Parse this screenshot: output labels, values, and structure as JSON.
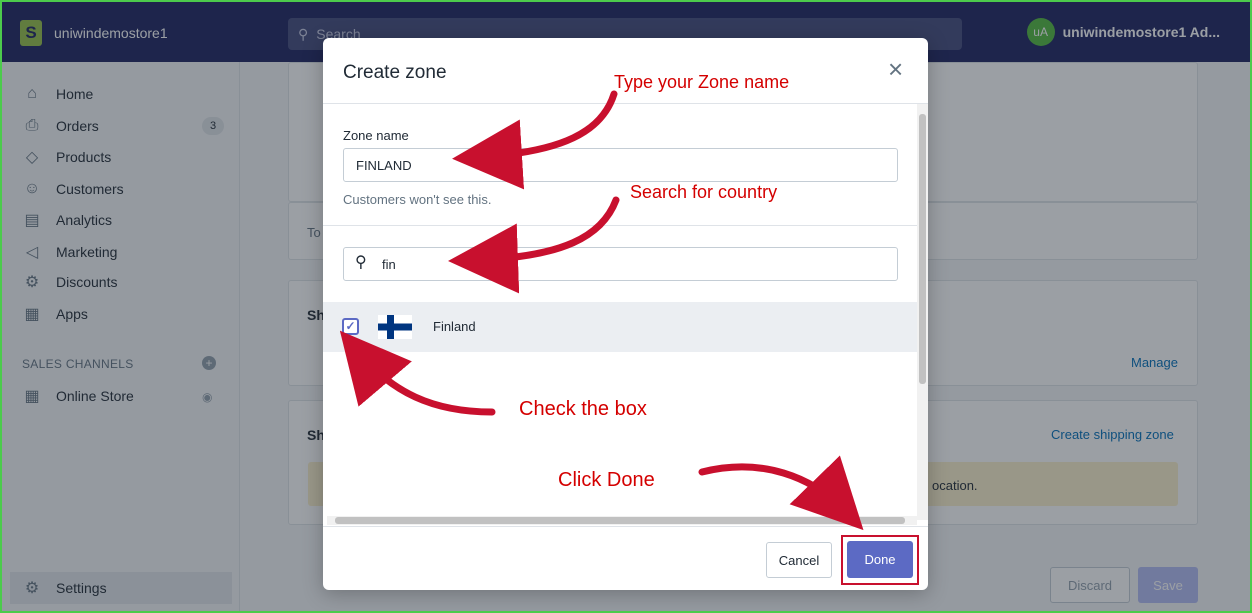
{
  "topbar": {
    "store_name": "uniwindemostore1",
    "search_placeholder": "Search",
    "avatar_initials": "uA",
    "user_label": "uniwindemostore1 Ad..."
  },
  "sidebar": {
    "items": [
      {
        "label": "Home",
        "icon": "home-icon"
      },
      {
        "label": "Orders",
        "icon": "orders-icon",
        "badge": "3"
      },
      {
        "label": "Products",
        "icon": "tag-icon"
      },
      {
        "label": "Customers",
        "icon": "person-icon"
      },
      {
        "label": "Analytics",
        "icon": "bar-chart-icon"
      },
      {
        "label": "Marketing",
        "icon": "megaphone-icon"
      },
      {
        "label": "Discounts",
        "icon": "discount-icon"
      },
      {
        "label": "Apps",
        "icon": "apps-icon"
      }
    ],
    "sales_channels_label": "SALES CHANNELS",
    "online_store_label": "Online Store",
    "settings_label": "Settings"
  },
  "background": {
    "to_text": "To",
    "sh_heading_1": "Sh",
    "sh_heading_2": "Sh",
    "manage_link": "Manage",
    "create_zone_link": "Create shipping zone",
    "location_text": "ocation.",
    "discard_label": "Discard",
    "save_label": "Save"
  },
  "modal": {
    "title": "Create zone",
    "zone_name_label": "Zone name",
    "zone_name_value": "FINLAND",
    "zone_help": "Customers won't see this.",
    "search_value": "fin",
    "country": {
      "name": "Finland",
      "checked": true
    },
    "cancel_label": "Cancel",
    "done_label": "Done"
  },
  "annotations": {
    "type_zone": "Type your Zone name",
    "search_country": "Search for country",
    "check_box": "Check the box",
    "click_done": "Click Done"
  },
  "colors": {
    "topbar": "#1c2260",
    "accent": "#5c6ac4",
    "annotation": "#d40000",
    "frame_border": "#4ccb4c"
  }
}
